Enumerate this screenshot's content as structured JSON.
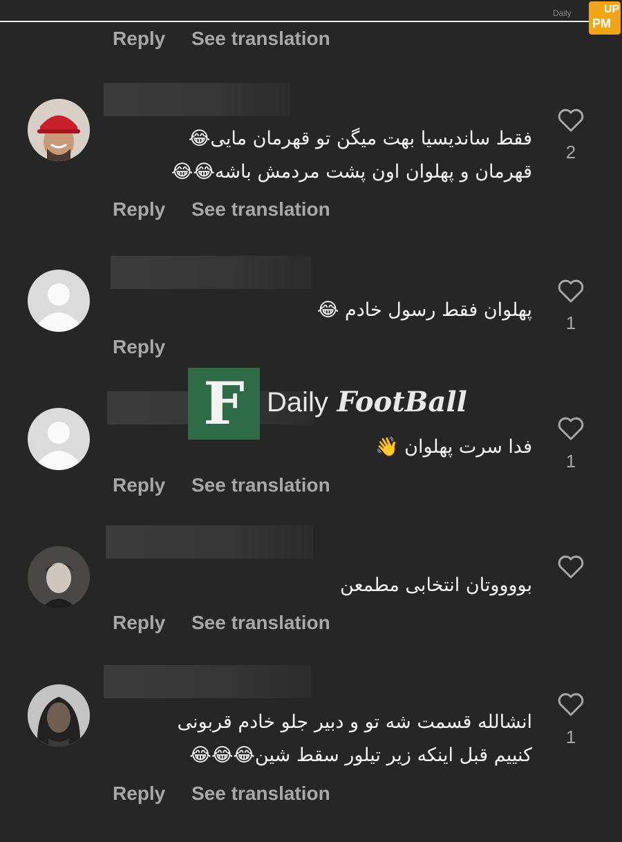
{
  "watermark": {
    "badge_top": "UP",
    "badge_bottom": "PM",
    "small_text": "Daily"
  },
  "top_actions": {
    "reply": "Reply",
    "see_translation": "See translation"
  },
  "comments": [
    {
      "avatar": "photo-red-cap",
      "lines": [
        "فقط ساندیسیا بهت میگن تو قهرمان مایی😂",
        "قهرمان و پهلوان اون پشت مردمش باشه😂😂"
      ],
      "likes": "2",
      "reply": "Reply",
      "see_translation": "See translation"
    },
    {
      "avatar": "default",
      "lines": [
        "پهلوان فقط رسول خادم 😂"
      ],
      "likes": "1",
      "reply": "Reply"
    },
    {
      "avatar": "default",
      "lines": [
        "فدا سرت پهلوان 👋"
      ],
      "likes": "1",
      "reply": "Reply",
      "see_translation": "See translation"
    },
    {
      "avatar": "photo-dark-portrait",
      "lines": [
        "بووووتان انتخابی مطمعن"
      ],
      "likes": "",
      "reply": "Reply",
      "see_translation": "See translation"
    },
    {
      "avatar": "photo-bw-portrait",
      "lines": [
        "انشالله قسمت شه تو و دبیر جلو خادم قربونی",
        "کنییم قبل اینکه زیر تیلور سقط شین😂😂😂"
      ],
      "likes": "1",
      "reply": "Reply",
      "see_translation": "See translation"
    }
  ],
  "overlay_logo": {
    "letter": "F",
    "word1": "Daily",
    "word2": "FootBall",
    "color": "#2f6b47"
  },
  "colors": {
    "background": "#262626",
    "text": "#f5f5f5",
    "secondary": "#a8a8a8",
    "badge": "#f2a516"
  }
}
